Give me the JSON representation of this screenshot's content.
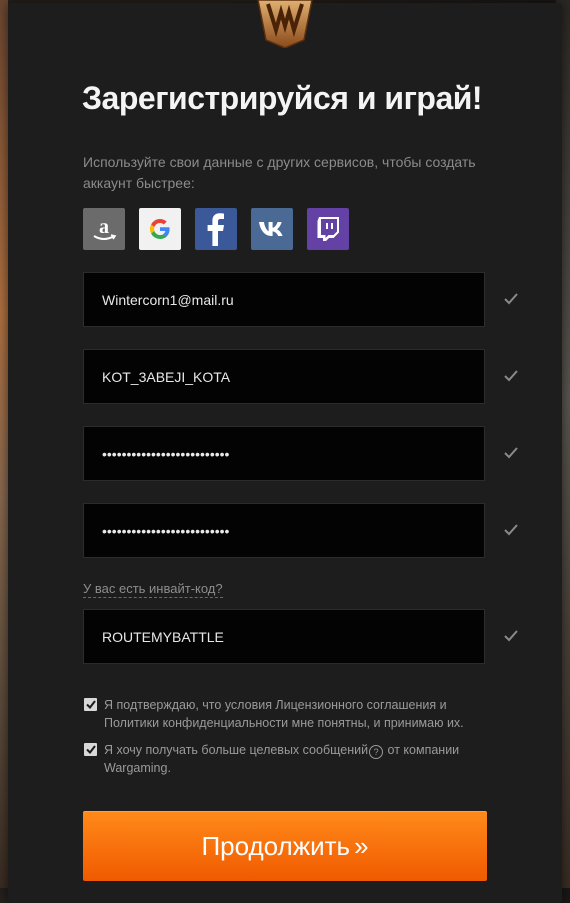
{
  "header": {
    "title": "Зарегистрируйся и играй!",
    "subtitle": "Используйте свои данные с других сервисов, чтобы создать аккаунт быстрее:"
  },
  "social": [
    {
      "name": "amazon",
      "icon": "amazon-icon",
      "color": "#6b6b6b"
    },
    {
      "name": "google",
      "icon": "google-icon",
      "color": "#f1f1f1"
    },
    {
      "name": "facebook",
      "icon": "facebook-icon",
      "color": "#3b5998"
    },
    {
      "name": "vk",
      "icon": "vk-icon",
      "color": "#4a6a95"
    },
    {
      "name": "twitch",
      "icon": "twitch-icon",
      "color": "#6441a5"
    }
  ],
  "form": {
    "email": "Wintercorn1@mail.ru",
    "nickname": "KOT_3ABEJI_KOTA",
    "password": "••••••••••••••••••••••••••",
    "password_confirm": "••••••••••••••••••••••••••",
    "invite_link": "У вас есть инвайт-код?",
    "invite_code": "ROUTEMYBATTLE"
  },
  "agreements": {
    "license": "Я подтверждаю, что условия Лицензионного соглашения и Политики конфиденциальности мне понятны, и принимаю их.",
    "marketing_before": "Я хочу получать больше целевых сообщений",
    "marketing_after": " от компании Wargaming.",
    "help_glyph": "?"
  },
  "actions": {
    "continue_label": "Продолжить",
    "continue_arrows": "»"
  },
  "colors": {
    "accent": "#f26a0a",
    "panel": "#1d1d1d",
    "field": "#030303"
  }
}
